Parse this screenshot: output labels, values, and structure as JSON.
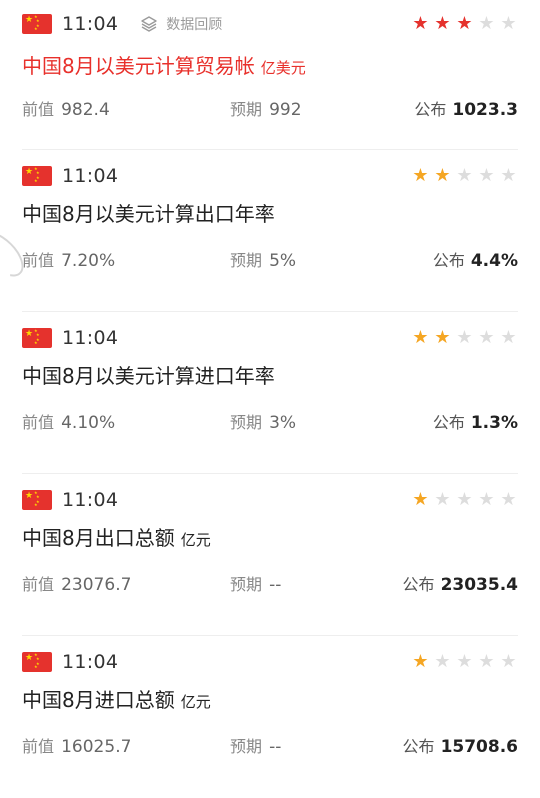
{
  "colors": {
    "star_red": "#e5322d",
    "star_gold": "#f5a623",
    "star_empty": "#dddddd",
    "highlight_title": "#e8302b"
  },
  "replay_label": "数据回顾",
  "labels": {
    "prev": "前值",
    "expected": "预期",
    "published": "公布"
  },
  "items": [
    {
      "time": "11:04",
      "title": "中国8月以美元计算贸易帐",
      "unit": "亿美元",
      "stars": 3,
      "star_color": "red",
      "prev": "982.4",
      "expected": "992",
      "published": "1023.3"
    },
    {
      "time": "11:04",
      "title": "中国8月以美元计算出口年率",
      "unit": "",
      "stars": 2,
      "star_color": "gold",
      "prev": "7.20%",
      "expected": "5%",
      "published": "4.4%"
    },
    {
      "time": "11:04",
      "title": "中国8月以美元计算进口年率",
      "unit": "",
      "stars": 2,
      "star_color": "gold",
      "prev": "4.10%",
      "expected": "3%",
      "published": "1.3%"
    },
    {
      "time": "11:04",
      "title": "中国8月出口总额",
      "unit": "亿元",
      "stars": 1,
      "star_color": "gold",
      "prev": "23076.7",
      "expected": "--",
      "published": "23035.4"
    },
    {
      "time": "11:04",
      "title": "中国8月进口总额",
      "unit": "亿元",
      "stars": 1,
      "star_color": "gold",
      "prev": "16025.7",
      "expected": "--",
      "published": "15708.6"
    }
  ]
}
